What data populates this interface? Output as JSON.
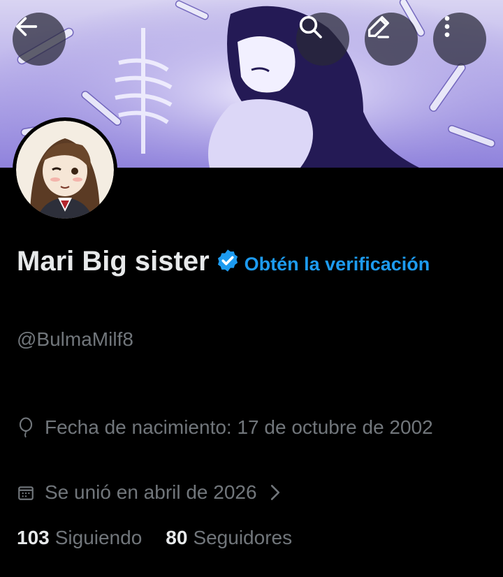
{
  "header": {
    "back_icon": "arrow-left-icon",
    "search_icon": "search-icon",
    "edit_icon": "pencil-icon",
    "more_icon": "more-vertical-icon"
  },
  "profile": {
    "display_name": "Mari Big sister",
    "verified_badge_icon": "verified-badge-icon",
    "verification_cta": "Obtén la verificación",
    "handle": "@BulmaMilf8",
    "birth_icon": "balloon-icon",
    "birth_text": "Fecha de nacimiento: 17 de octubre de 2002",
    "joined_icon": "calendar-icon",
    "joined_text": "Se unió en abril de 2026",
    "following_count": "103",
    "following_label": "Siguiendo",
    "followers_count": "80",
    "followers_label": "Seguidores"
  },
  "colors": {
    "background": "#000000",
    "text_primary": "#e7e9ea",
    "text_secondary": "#71767b",
    "accent": "#1d9bf0"
  }
}
